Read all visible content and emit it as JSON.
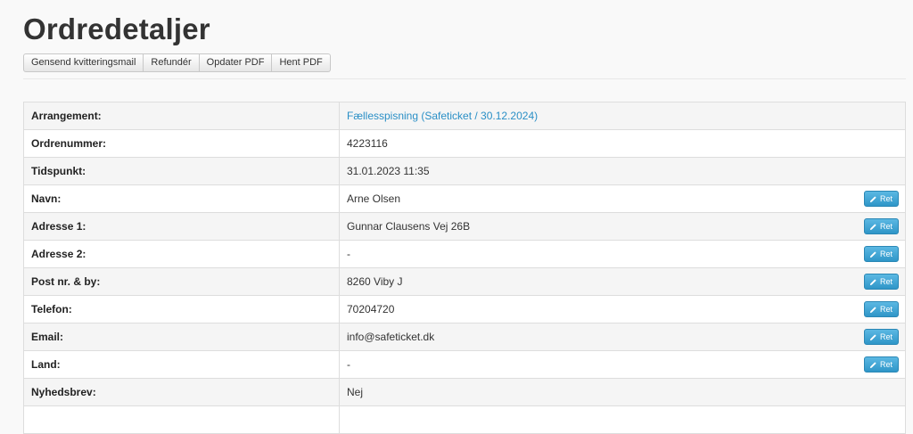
{
  "page": {
    "title": "Ordredetaljer"
  },
  "toolbar": {
    "resend_label": "Gensend kvitteringsmail",
    "refund_label": "Refundér",
    "update_pdf_label": "Opdater PDF",
    "get_pdf_label": "Hent PDF"
  },
  "details": {
    "edit_label": "Ret",
    "icon": "pencil-icon",
    "rows": [
      {
        "label": "Arrangement:",
        "value": "Fællesspisning (Safeticket / 30.12.2024)"
      },
      {
        "label": "Ordrenummer:",
        "value": "4223116"
      },
      {
        "label": "Tidspunkt:",
        "value": "31.01.2023 11:35"
      },
      {
        "label": "Navn:",
        "value": "Arne Olsen"
      },
      {
        "label": "Adresse 1:",
        "value": "Gunnar Clausens Vej 26B"
      },
      {
        "label": "Adresse 2:",
        "value": "-"
      },
      {
        "label": "Post nr. & by:",
        "value": "8260 Viby J"
      },
      {
        "label": "Telefon:",
        "value": "70204720"
      },
      {
        "label": "Email:",
        "value": "info@safeticket.dk"
      },
      {
        "label": "Land:",
        "value": "-"
      },
      {
        "label": "Nyhedsbrev:",
        "value": "Nej"
      },
      {
        "label": "",
        "value": ""
      }
    ]
  },
  "colors": {
    "link": "#2a8fc6",
    "edit_button": "#3aa3d4"
  }
}
